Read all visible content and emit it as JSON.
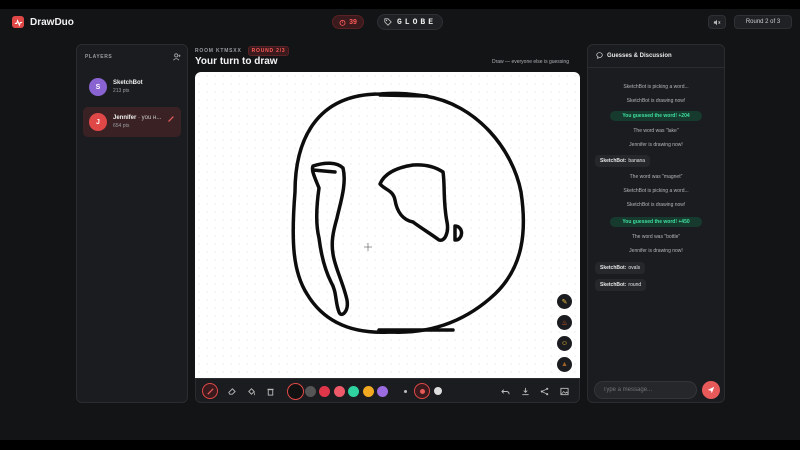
{
  "app": {
    "name": "DrawDuo",
    "accent": "#e04848"
  },
  "header": {
    "timer": "39",
    "word": "GLOBE",
    "round": "Round 2 of 3"
  },
  "players": {
    "title": "PLAYERS",
    "list": [
      {
        "initial": "S",
        "name": "SketchBot",
        "you": "",
        "points": "213 pts",
        "color": "#8a63d2"
      },
      {
        "initial": "J",
        "name": "Jennifer",
        "you": "· you н...",
        "points": "654 pts",
        "color": "#e04848"
      }
    ]
  },
  "room": {
    "label": "ROOM KTMSXX",
    "badge": "ROUND 2/3"
  },
  "turn": {
    "title": "Your turn to draw",
    "note": "Draw — everyone else is guessing"
  },
  "palette": [
    "#111111",
    "#555555",
    "#e0364a",
    "#ee5a6a",
    "#2fd3a0",
    "#f0a920",
    "#9b6be0"
  ],
  "chat": {
    "title": "Guesses & Discussion",
    "messages": [
      {
        "type": "system",
        "text": "SketchBot is picking a word..."
      },
      {
        "type": "system",
        "text": "SketchBot is drawing now!"
      },
      {
        "type": "guessed",
        "text": "You guessed the word!  +204"
      },
      {
        "type": "system",
        "text": "The word was \"lake\""
      },
      {
        "type": "system",
        "text": "Jennifer is drawing now!"
      },
      {
        "type": "user",
        "user": "SketchBot:",
        "text": "banana"
      },
      {
        "type": "system",
        "text": "The word was \"magnet\""
      },
      {
        "type": "system",
        "text": "SketchBot is picking a word..."
      },
      {
        "type": "system",
        "text": "SketchBot is drawing now!"
      },
      {
        "type": "guessed",
        "text": "You guessed the word!  +450"
      },
      {
        "type": "system",
        "text": "The word was \"bottle\""
      },
      {
        "type": "system",
        "text": "Jennifer is drawing now!"
      },
      {
        "type": "user",
        "user": "SketchBot:",
        "text": "ovals"
      },
      {
        "type": "user",
        "user": "SketchBot:",
        "text": "round"
      }
    ],
    "input_placeholder": "Type a message..."
  }
}
